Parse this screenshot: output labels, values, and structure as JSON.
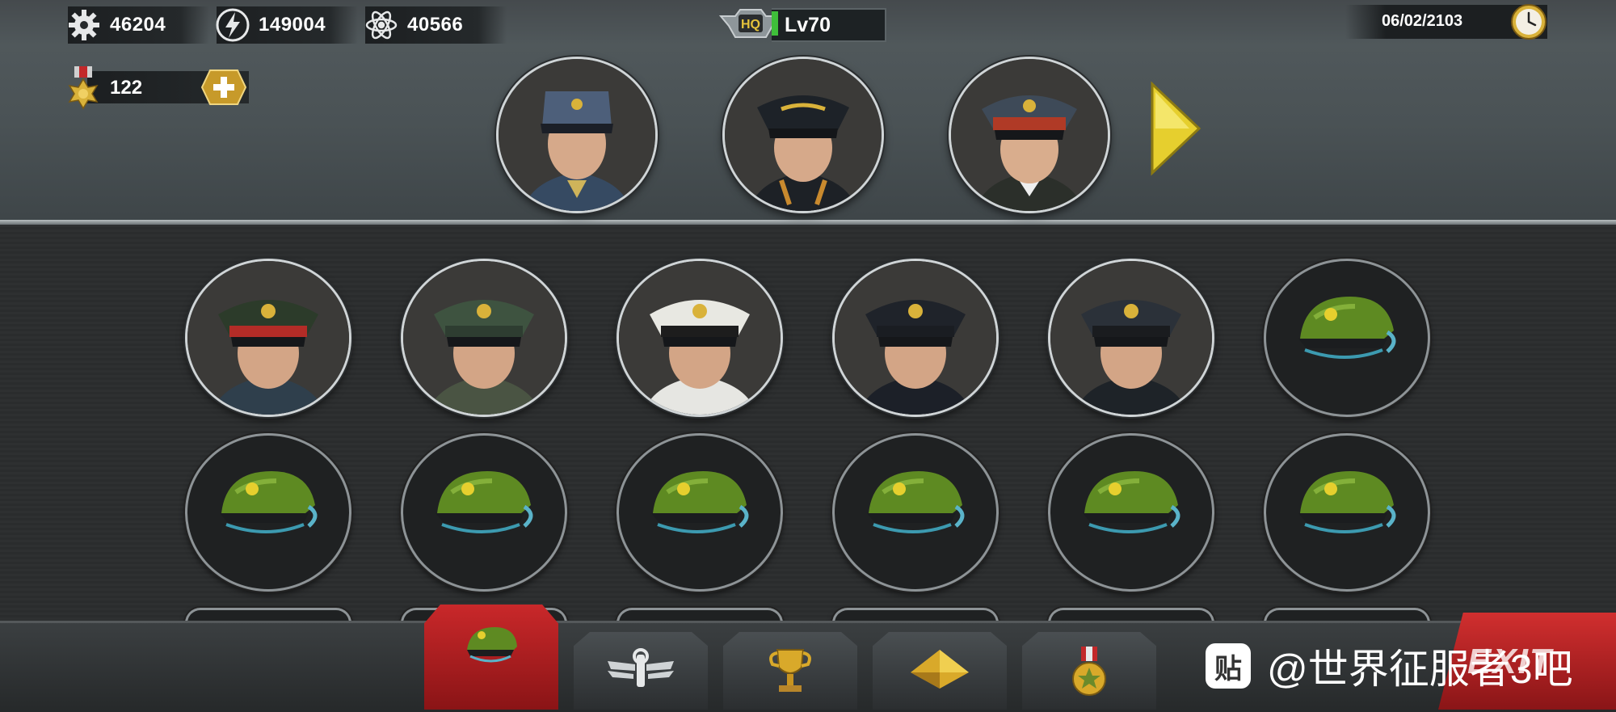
{
  "resources": {
    "gear": "46204",
    "energy": "149004",
    "atom": "40566",
    "medals": "122"
  },
  "hq": {
    "badge": "HQ",
    "level": "Lv70"
  },
  "date": "06/02/2103",
  "featured_generals": [
    {
      "name": "general-blue-cap"
    },
    {
      "name": "general-black-cap"
    },
    {
      "name": "general-red-band-cap"
    }
  ],
  "roster": {
    "row1": [
      {
        "kind": "portrait",
        "cap": "#2c3b2a",
        "band": "#b32c27",
        "tunic": "#2f3f4c"
      },
      {
        "kind": "portrait",
        "cap": "#3e5340",
        "band": "#2e3d31",
        "tunic": "#4a5443"
      },
      {
        "kind": "portrait",
        "cap": "#e8e8e2",
        "band": "#1d1d1d",
        "tunic": "#e6e6e2"
      },
      {
        "kind": "portrait",
        "cap": "#1f232a",
        "band": "#1a1d22",
        "tunic": "#1c2028"
      },
      {
        "kind": "portrait",
        "cap": "#2b3139",
        "band": "#1a1c1f",
        "tunic": "#1e2328"
      },
      {
        "kind": "empty"
      }
    ],
    "row2": [
      {
        "kind": "empty"
      },
      {
        "kind": "empty"
      },
      {
        "kind": "empty"
      },
      {
        "kind": "empty"
      },
      {
        "kind": "empty"
      },
      {
        "kind": "empty"
      }
    ]
  },
  "tabs": [
    {
      "name": "generals",
      "active": true
    },
    {
      "name": "skills",
      "active": false
    },
    {
      "name": "trophies",
      "active": false
    },
    {
      "name": "ranks",
      "active": false
    },
    {
      "name": "medals",
      "active": false
    }
  ],
  "exit_label": "EXIT",
  "watermark": {
    "icon_text": "贴",
    "text": "@世界征服者3吧"
  },
  "colors": {
    "accent_red": "#c9282a",
    "cap_green": "#5e8a22",
    "gold": "#d9b23a"
  }
}
